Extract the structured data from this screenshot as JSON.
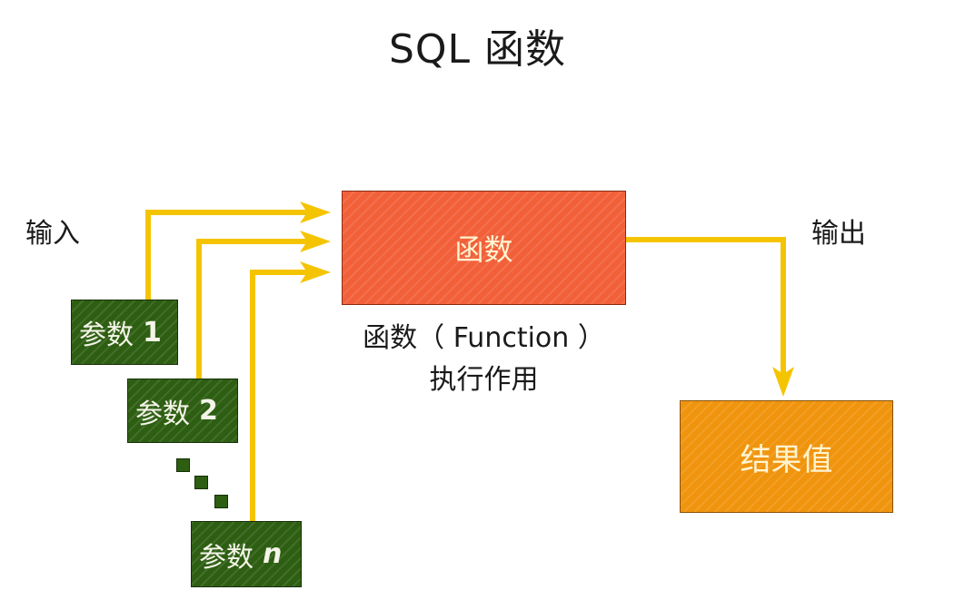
{
  "title": "SQL 函数",
  "input_label": "输入",
  "output_label": "输出",
  "function_box": {
    "label": "函数"
  },
  "caption": {
    "line1": "函数（ Function ）",
    "line2": "执行作用"
  },
  "result_box": {
    "label": "结果值"
  },
  "params": [
    {
      "prefix": "参数",
      "index": "1"
    },
    {
      "prefix": "参数",
      "index": "2"
    },
    {
      "prefix": "参数",
      "index": "n"
    }
  ],
  "colors": {
    "arrow": "#f5c400",
    "function_box": "#f2603a",
    "result_box": "#f0940e",
    "param_box": "#2d5e12"
  }
}
